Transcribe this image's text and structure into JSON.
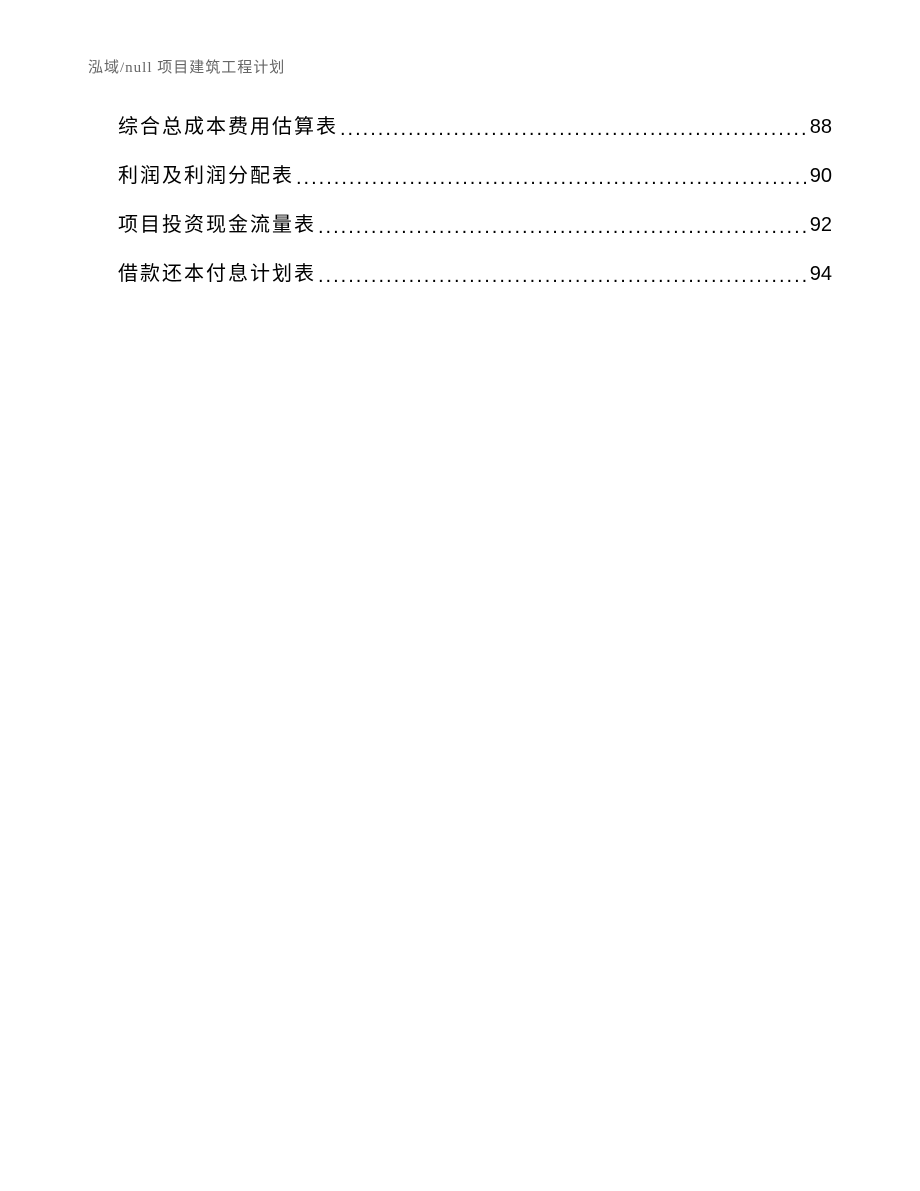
{
  "header": "泓域/null 项目建筑工程计划",
  "toc": {
    "entries": [
      {
        "title": "综合总成本费用估算表",
        "page": "88"
      },
      {
        "title": "利润及利润分配表",
        "page": "90"
      },
      {
        "title": "项目投资现金流量表",
        "page": "92"
      },
      {
        "title": "借款还本付息计划表",
        "page": "94"
      }
    ]
  }
}
